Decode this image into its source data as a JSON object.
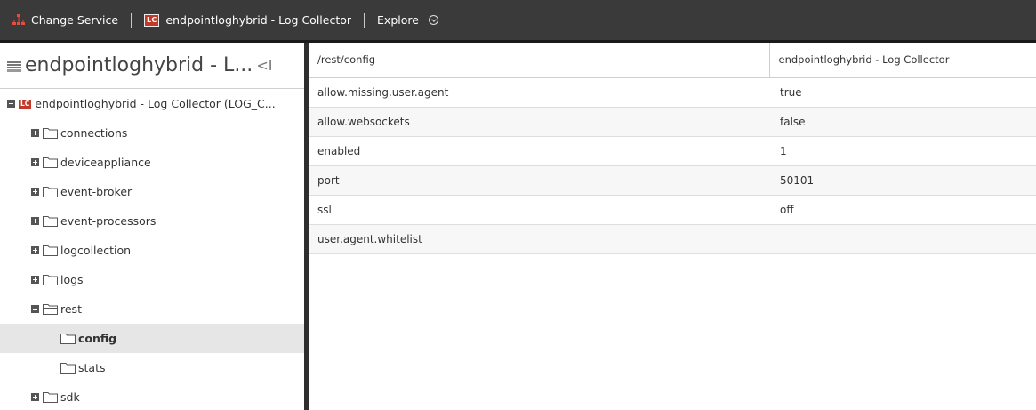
{
  "toolbar": {
    "change_service": "Change Service",
    "service_badge": "LC",
    "service_name": "endpointloghybrid - Log Collector",
    "explore": "Explore"
  },
  "sidebar": {
    "header_title": "endpointloghybrid - L...",
    "collapse_glyph": "<I",
    "root": {
      "badge": "LC",
      "label": "endpointloghybrid - Log Collector (LOG_C..."
    },
    "items": [
      {
        "label": "connections",
        "state": "collapsed"
      },
      {
        "label": "deviceappliance",
        "state": "collapsed"
      },
      {
        "label": "event-broker",
        "state": "collapsed"
      },
      {
        "label": "event-processors",
        "state": "collapsed"
      },
      {
        "label": "logcollection",
        "state": "collapsed"
      },
      {
        "label": "logs",
        "state": "collapsed"
      },
      {
        "label": "rest",
        "state": "expanded"
      },
      {
        "label": "config",
        "state": "selected-child"
      },
      {
        "label": "stats",
        "state": "child"
      },
      {
        "label": "sdk",
        "state": "collapsed"
      }
    ]
  },
  "table": {
    "headers": [
      "/rest/config",
      "endpointloghybrid - Log Collector"
    ],
    "rows": [
      {
        "key": "allow.missing.user.agent",
        "value": "true"
      },
      {
        "key": "allow.websockets",
        "value": "false"
      },
      {
        "key": "enabled",
        "value": "1"
      },
      {
        "key": "port",
        "value": "50101"
      },
      {
        "key": "ssl",
        "value": "off"
      },
      {
        "key": "user.agent.whitelist",
        "value": ""
      }
    ]
  },
  "colors": {
    "toolbar_bg": "#3a3a3a",
    "badge_red": "#c0392b",
    "selected_row": "#e6e6e6"
  }
}
